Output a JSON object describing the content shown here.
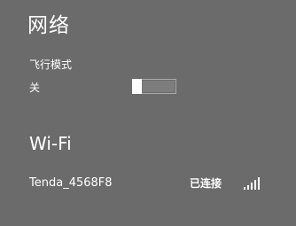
{
  "panel": {
    "title": "网络"
  },
  "airplane_mode": {
    "label": "飞行模式",
    "state_text": "关",
    "enabled": false
  },
  "wifi": {
    "heading": "Wi-Fi",
    "networks": [
      {
        "name": "Tenda_4568F8",
        "status": "已连接",
        "signal_icon": "wifi-signal-icon",
        "signal_bars": 5
      }
    ]
  },
  "colors": {
    "background": "#6b6b6b",
    "text": "#ffffff",
    "toggle_border": "#aaaaaa",
    "toggle_track": "#7d7d7d",
    "toggle_thumb": "#ffffff"
  }
}
